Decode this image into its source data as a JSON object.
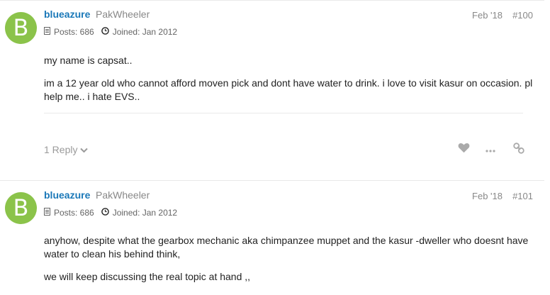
{
  "posts": [
    {
      "avatar_letter": "B",
      "avatar_color": "#8bc34a",
      "username": "blueazure",
      "fullname": "PakWheeler",
      "posts_label": "Posts: 686",
      "joined_label": "Joined: Jan 2012",
      "date": "Feb '18",
      "post_number": "#100",
      "paragraphs": [
        "my name is capsat..",
        "im a 12 year old who cannot afford moven pick and dont have water to drink. i love to visit kasur on occasion. pl help me.. i hate EVS.."
      ],
      "reply_label": "1 Reply"
    },
    {
      "avatar_letter": "B",
      "avatar_color": "#8bc34a",
      "username": "blueazure",
      "fullname": "PakWheeler",
      "posts_label": "Posts: 686",
      "joined_label": "Joined: Jan 2012",
      "date": "Feb '18",
      "post_number": "#101",
      "paragraphs": [
        "anyhow, despite what the gearbox mechanic aka chimpanzee muppet and the kasur -dweller who doesnt have water to clean his behind think,",
        "we will keep discussing the real topic at hand ,,"
      ]
    }
  ],
  "icons": {
    "posts": "document-icon",
    "joined": "clock-icon",
    "like": "heart-icon",
    "more": "ellipsis-icon",
    "share": "link-icon",
    "reply_toggle": "chevron-down-icon"
  },
  "colors": {
    "username": "#1a78b8",
    "muted": "#888888",
    "avatar_bg": "#8bc34a",
    "action_icon": "#aaaaaa"
  }
}
